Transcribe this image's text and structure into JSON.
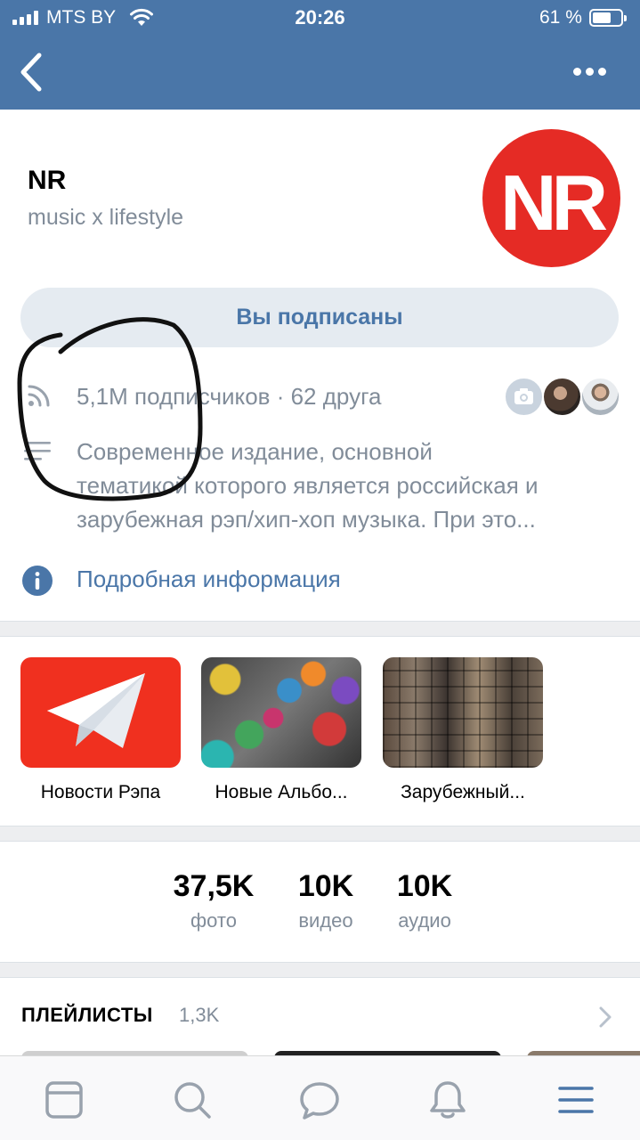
{
  "status_bar": {
    "carrier": "MTS BY",
    "time": "20:26",
    "battery": "61 %",
    "battery_level": 0.61
  },
  "group": {
    "name": "NR",
    "status": "music x lifestyle",
    "avatar_text": "NR"
  },
  "subscribe_button": {
    "label": "Вы подписаны"
  },
  "stats_line": "5,1M подписчиков · 62 друга",
  "description": {
    "line1": "Современное издание, основной",
    "line2": "тематикой которого является российская и",
    "line3": "зарубежная рэп/хип-хоп музыка. При это..."
  },
  "more_info": "Подробная информация",
  "albums": [
    {
      "label": "Новости Рэпа"
    },
    {
      "label": "Новые Альбо..."
    },
    {
      "label": "Зарубежный..."
    }
  ],
  "counters": [
    {
      "value": "37,5K",
      "label": "фото"
    },
    {
      "value": "10K",
      "label": "видео"
    },
    {
      "value": "10K",
      "label": "аудио"
    }
  ],
  "playlists": {
    "title": "ПЛЕЙЛИСТЫ",
    "count": "1,3K"
  },
  "tabs": [
    "news-icon",
    "search-icon",
    "messages-icon",
    "notifications-icon",
    "menu-icon"
  ],
  "colors": {
    "header": "#4a76a8",
    "accent": "#4a76a8",
    "avatar_bg": "#e52b25",
    "secondary_text": "#818c99"
  }
}
